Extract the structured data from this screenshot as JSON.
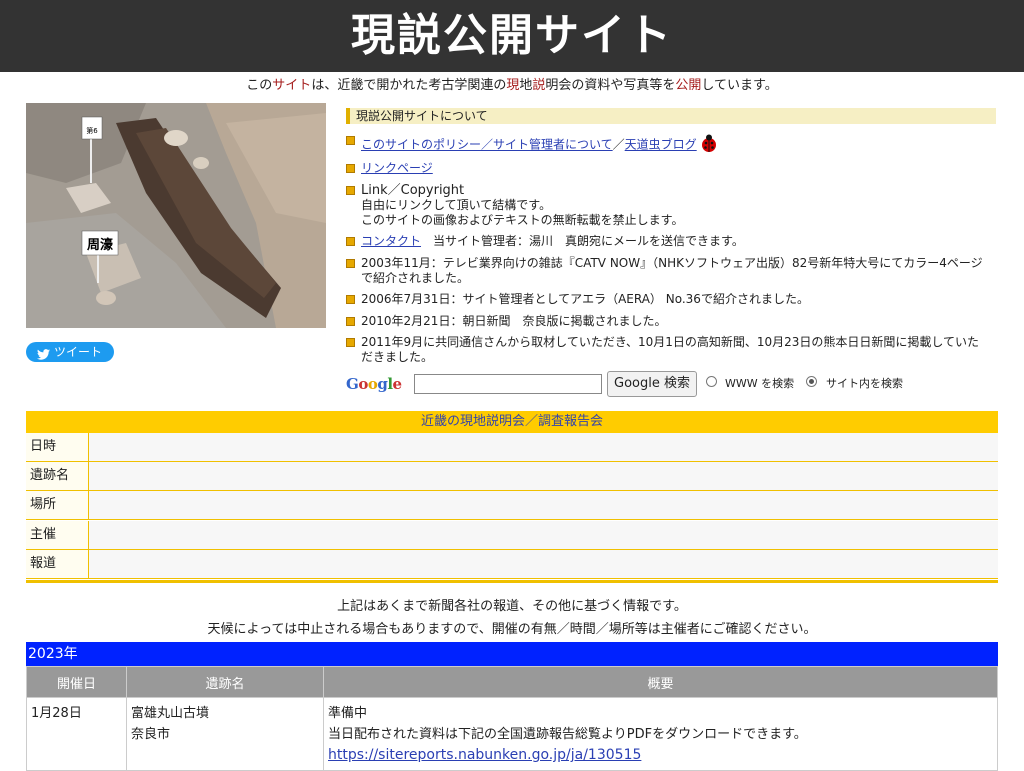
{
  "header": {
    "title": "現説公開サイト"
  },
  "intro": {
    "p1": "この",
    "p2": "サイト",
    "p3": "は、近畿で開かれた考古学関連の",
    "p4": "現",
    "p5": "地",
    "p6": "説",
    "p7": "明会の資料や写真等を",
    "p8": "公開",
    "p9": "しています。"
  },
  "photo": {
    "sign_small": "周溝",
    "sign_big": "周濠",
    "sign_post": "第6"
  },
  "tweet": {
    "label": "ツイート"
  },
  "about": {
    "heading": "現説公開サイトについて",
    "policy_link": "このサイトのポリシー／サイト管理者について",
    "slash": "／",
    "blog_link": "天道虫ブログ",
    "links_link": "リンクページ",
    "copyright_title": "Link／Copyright",
    "copyright_line1": "自由にリンクして頂いて結構です。",
    "copyright_line2": "このサイトの画像およびテキストの無断転載を禁止します。",
    "contact_link": "コンタクト",
    "contact_text": "当サイト管理者：湯川　真朗宛にメールを送信できます。",
    "news": [
      "2003年11月：テレビ業界向けの雑誌『CATV NOW』（NHKソフトウェア出版）82号新年特大号にてカラー4ページで紹介されました。",
      "2006年7月31日：サイト管理者としてアエラ（AERA） No.36で紹介されました。",
      "2010年2月21日：朝日新聞　奈良版に掲載されました。",
      "2011年9月に共同通信さんから取材していただき、10月1日の高知新聞、10月23日の熊本日日新聞に掲載していただきました。"
    ]
  },
  "search": {
    "logo": "Google",
    "input_value": "",
    "button": "Google 検索",
    "option_www": "WWW を検索",
    "option_site": "サイト内を検索",
    "selected": "サイト内を検索"
  },
  "events": {
    "heading": "近畿の現地説明会／調査報告会",
    "rows": [
      {
        "key": "日時",
        "value": ""
      },
      {
        "key": "遺跡名",
        "value": ""
      },
      {
        "key": "場所",
        "value": ""
      },
      {
        "key": "主催",
        "value": ""
      },
      {
        "key": "報道",
        "value": ""
      }
    ]
  },
  "notes": {
    "line1": "上記はあくまで新聞各社の報道、その他に基づく情報です。",
    "line2": "天候によっては中止される場合もありますので、開催の有無／時間／場所等は主催者にご確認ください。"
  },
  "year": "2023年",
  "table": {
    "headers": [
      "開催日",
      "遺跡名",
      "概要"
    ],
    "rows": [
      {
        "date": "1月28日",
        "site": "富雄丸山古墳",
        "place": "奈良市",
        "summary_status": "準備中",
        "summary_text": "当日配布された資料は下記の全国遺跡報告総覧よりPDFをダウンロードできます。",
        "summary_link": "https://sitereports.nabunken.go.jp/ja/130515"
      }
    ]
  },
  "colors": {
    "header_bg": "#333333",
    "accent_yellow": "#ffcc00",
    "year_bar": "#0022ff",
    "link": "#2a3fb3",
    "red_text": "#a51d1d"
  }
}
